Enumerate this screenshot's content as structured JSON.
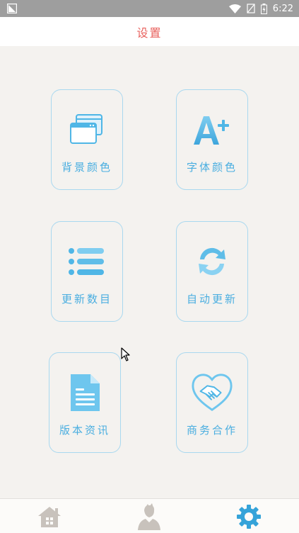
{
  "status_bar": {
    "time": "6:22",
    "icons": [
      "notification-icon",
      "wifi-icon",
      "no-signal-icon",
      "battery-charging-icon"
    ]
  },
  "header": {
    "title": "设置"
  },
  "tiles": [
    {
      "label": "背景颜色",
      "icon": "windows-icon"
    },
    {
      "label": "字体颜色",
      "icon": "font-plus-icon"
    },
    {
      "label": "更新数目",
      "icon": "list-icon"
    },
    {
      "label": "自动更新",
      "icon": "refresh-icon"
    },
    {
      "label": "版本资讯",
      "icon": "document-icon"
    },
    {
      "label": "商务合作",
      "icon": "handshake-icon"
    }
  ],
  "bottom_nav": {
    "items": [
      {
        "icon": "home-icon",
        "active": false
      },
      {
        "icon": "user-icon",
        "active": false
      },
      {
        "icon": "settings-gear-icon",
        "active": true
      }
    ]
  },
  "colors": {
    "accent_title": "#e8605c",
    "tile_border": "#a9d8ef",
    "tile_label": "#4aaee0",
    "icon_blue": "#4fb6e6",
    "icon_light": "#9ad8f4",
    "nav_inactive": "#c8c2bc",
    "nav_active": "#35a3d9"
  }
}
